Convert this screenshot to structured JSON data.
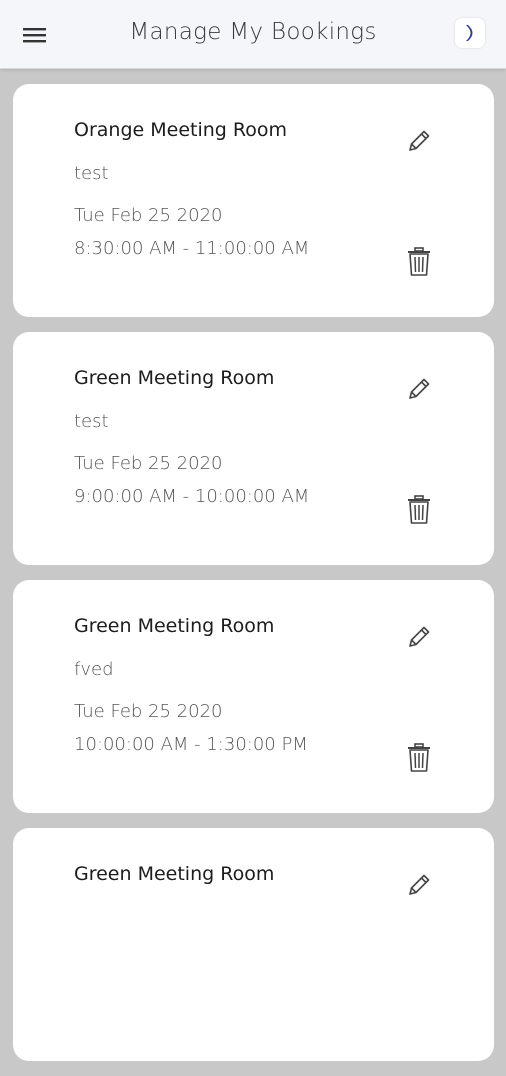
{
  "header": {
    "title": "Manage My Bookings",
    "menu_icon": "hamburger-menu-icon",
    "logo_icon": "app-logo-icon",
    "logo_color": "#2b3f8f"
  },
  "bookings": [
    {
      "room": "Orange Meeting Room",
      "note": "test",
      "date": "Tue Feb 25 2020",
      "time": "8:30:00 AM - 11:00:00 AM"
    },
    {
      "room": "Green Meeting Room",
      "note": "test",
      "date": "Tue Feb 25 2020",
      "time": "9:00:00 AM - 10:00:00 AM"
    },
    {
      "room": "Green Meeting Room",
      "note": "fved",
      "date": "Tue Feb 25 2020",
      "time": "10:00:00 AM - 1:30:00 PM"
    },
    {
      "room": "Green Meeting Room",
      "note": "",
      "date": "",
      "time": ""
    }
  ],
  "icons": {
    "edit": "pencil-icon",
    "delete": "trash-icon"
  },
  "colors": {
    "background": "#c8c8c8",
    "card": "#ffffff",
    "header": "#f5f6fa"
  }
}
